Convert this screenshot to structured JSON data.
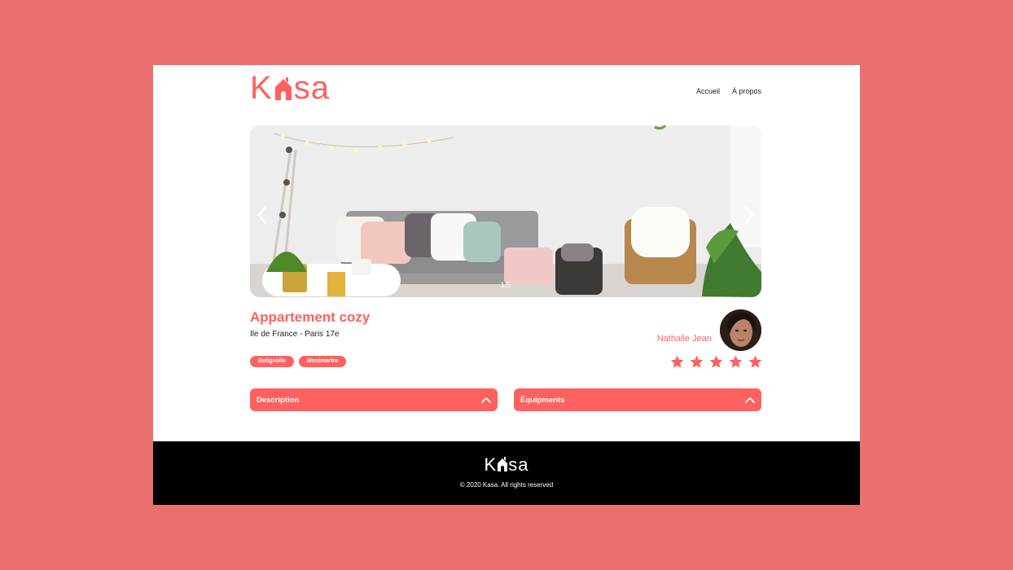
{
  "header": {
    "logo_left": "K",
    "logo_right": "sa",
    "nav": [
      {
        "label": "Accueil"
      },
      {
        "label": "À propos"
      }
    ]
  },
  "gallery": {
    "counter": "1/5",
    "current": 1,
    "total": 5,
    "prev_icon": "chevron-left-icon",
    "next_icon": "chevron-right-icon"
  },
  "listing": {
    "title": "Appartement cozy",
    "location": "Ile de France - Paris 17e",
    "tags": [
      "Batignolle",
      "Montmartre"
    ],
    "host": {
      "name": "Nathalie Jean"
    },
    "rating": 5,
    "rating_max": 5
  },
  "collapses": [
    {
      "label": "Description",
      "icon": "chevron-up-icon"
    },
    {
      "label": "Équipments",
      "icon": "chevron-up-icon"
    }
  ],
  "footer": {
    "logo_left": "K",
    "logo_right": "sa",
    "copyright": "© 2020 Kasa. All rights reserved"
  },
  "colors": {
    "background": "#eb7070",
    "accent": "#ff6060",
    "footer": "#000000"
  }
}
